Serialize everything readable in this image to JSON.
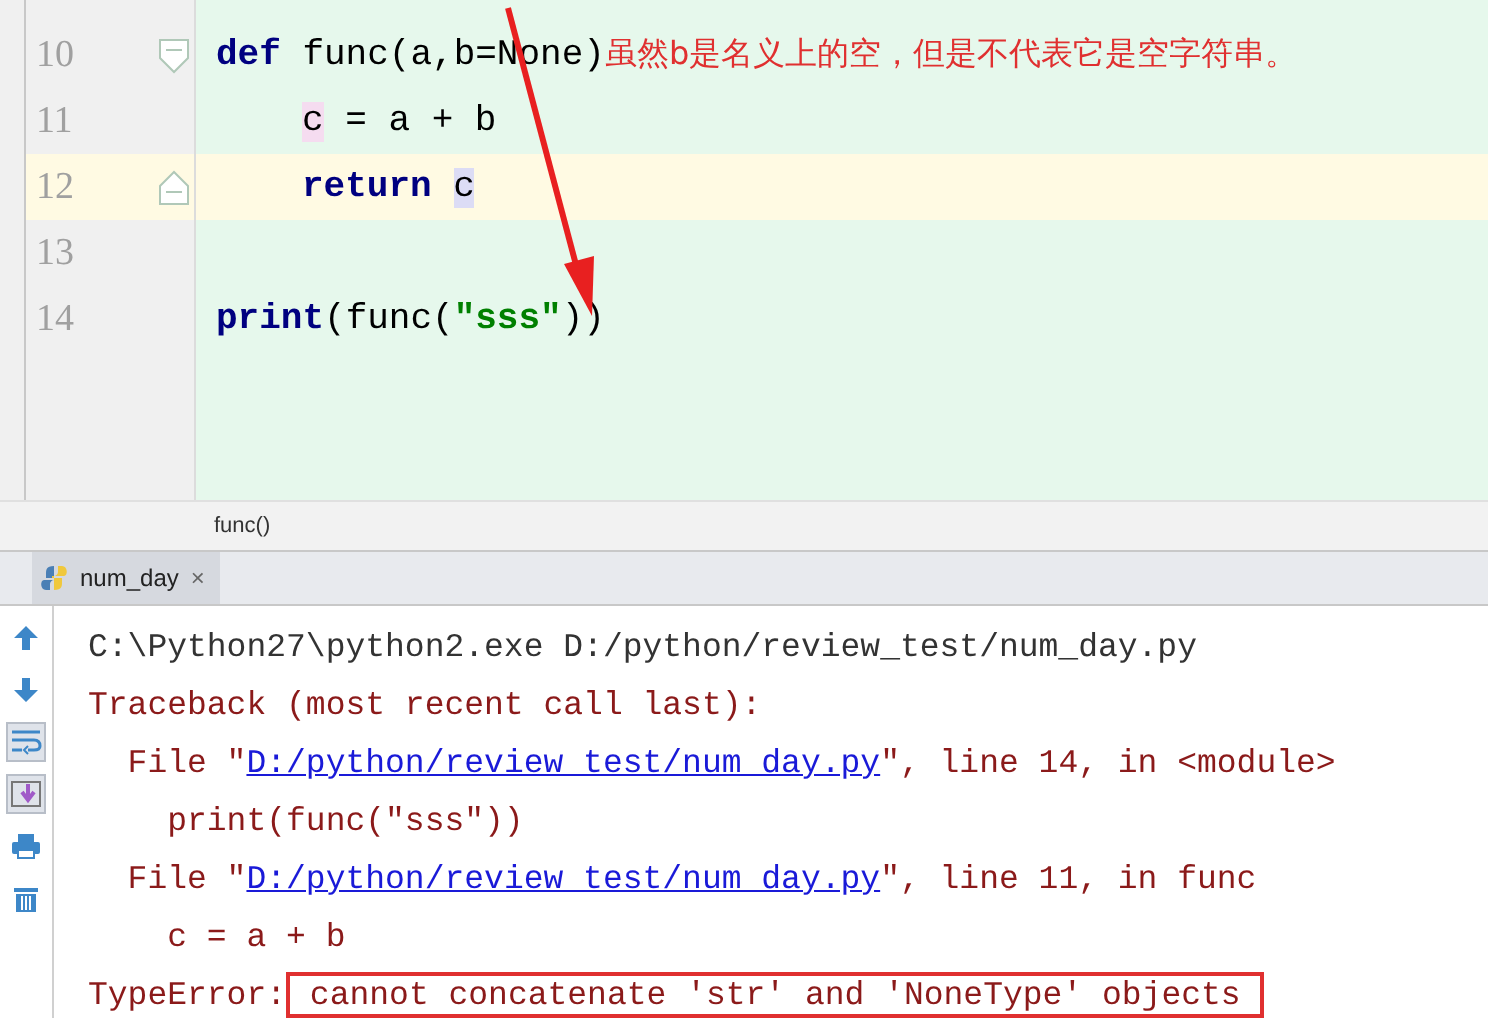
{
  "editor": {
    "lines": [
      {
        "number": "10",
        "current": false,
        "fold": {
          "kind": "start"
        },
        "tokens": [
          {
            "kind": "keyword",
            "text": "def"
          },
          {
            "kind": "text",
            "text": " func(a,b=None)"
          }
        ],
        "annotation": "虽然b是名义上的空，但是不代表它是空字符串。",
        "children": [
          {
            "number": "11",
            "current": false,
            "tokens": [
              {
                "kind": "write",
                "text": "c"
              },
              {
                "kind": "text",
                "text": " = a + b"
              }
            ]
          },
          {
            "number": "12",
            "current": true,
            "fold": {
              "kind": "end"
            },
            "tokens": [
              {
                "kind": "keyword",
                "text": "return "
              },
              {
                "kind": "read",
                "text": "c"
              }
            ]
          }
        ]
      },
      {
        "number": "13",
        "current": false
      },
      {
        "number": "14",
        "current": false,
        "tokens": [
          {
            "kind": "keyword",
            "text": "print"
          },
          {
            "kind": "text",
            "text": "(func("
          },
          {
            "kind": "string",
            "text": "\"sss\""
          },
          {
            "kind": "text",
            "text": "))"
          }
        ]
      }
    ],
    "breadcrumb": "func()"
  },
  "run_tab": {
    "label": "num_day",
    "selected": true,
    "close": "×"
  },
  "console": {
    "tools": [
      {
        "kind": "up",
        "selected": false
      },
      {
        "kind": "down",
        "selected": false
      },
      {
        "kind": "wrap",
        "selected": true
      },
      {
        "kind": "scroll-end",
        "selected": true
      },
      {
        "kind": "print",
        "selected": false
      },
      {
        "kind": "trash",
        "selected": false
      }
    ],
    "lines": [
      {
        "kind": "command",
        "segments": [
          {
            "kind": "text",
            "text": "C:\\Python27\\python2.exe D:/python/review_test/num_day.py"
          }
        ]
      },
      {
        "kind": "error",
        "segments": [
          {
            "kind": "text",
            "text": "Traceback (most recent call last):"
          }
        ]
      },
      {
        "kind": "error",
        "segments": [
          {
            "kind": "text",
            "text": "  File \""
          },
          {
            "kind": "link",
            "text": "D:/python/review_test/num_day.py"
          },
          {
            "kind": "text",
            "text": "\", line 14, in <module>"
          }
        ]
      },
      {
        "kind": "error",
        "segments": [
          {
            "kind": "text",
            "text": "    print(func(\"sss\"))"
          }
        ]
      },
      {
        "kind": "error",
        "segments": [
          {
            "kind": "text",
            "text": "  File \""
          },
          {
            "kind": "link",
            "text": "D:/python/review_test/num_day.py"
          },
          {
            "kind": "text",
            "text": "\", line 11, in func"
          }
        ]
      },
      {
        "kind": "error",
        "segments": [
          {
            "kind": "text",
            "text": "    c = a + b"
          }
        ]
      },
      {
        "kind": "error",
        "segments": [
          {
            "kind": "text",
            "text": "TypeError:"
          },
          {
            "kind": "boxed",
            "text": " cannot concatenate 'str' and 'NoneType' objects"
          }
        ]
      }
    ]
  }
}
